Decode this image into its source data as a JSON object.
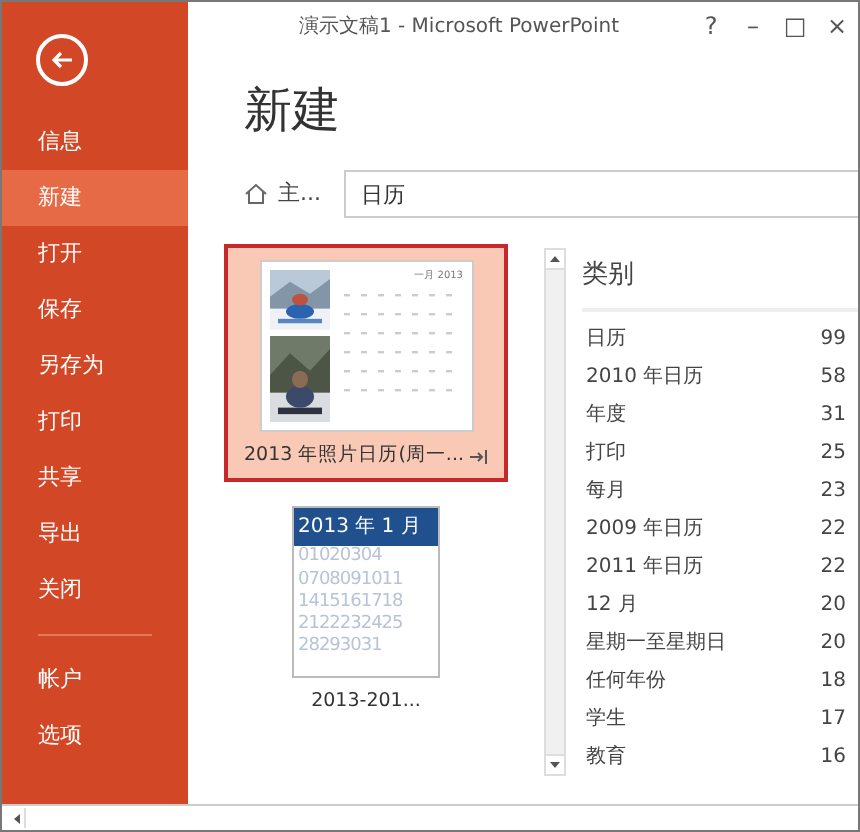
{
  "window": {
    "title": "演示文稿1 - Microsoft PowerPoint",
    "controls": [
      "?",
      "–",
      "□",
      "×"
    ]
  },
  "sidebar": {
    "items": [
      {
        "label": "信息",
        "selected": false
      },
      {
        "label": "新建",
        "selected": true
      },
      {
        "label": "打开",
        "selected": false
      },
      {
        "label": "保存",
        "selected": false
      },
      {
        "label": "另存为",
        "selected": false
      },
      {
        "label": "打印",
        "selected": false
      },
      {
        "label": "共享",
        "selected": false
      },
      {
        "label": "导出",
        "selected": false
      },
      {
        "label": "关闭",
        "selected": false
      }
    ],
    "footer_items": [
      {
        "label": "帐户",
        "selected": false
      },
      {
        "label": "选项",
        "selected": false
      }
    ]
  },
  "heading": "新建",
  "breadcrumb": "主...",
  "search": {
    "value": "日历"
  },
  "templates": [
    {
      "label": "2013 年照片日历(周一...",
      "selected": true,
      "month": "一月 2013"
    },
    {
      "kind": "table",
      "label": "2013-201...",
      "selected": false,
      "month": "2013 年 1 月",
      "rows": [
        "01020304",
        "0708091011",
        "1415161718",
        "2122232425",
        "28293031"
      ]
    }
  ],
  "categories": {
    "title": "类别",
    "items": [
      {
        "name": "日历",
        "count": "99"
      },
      {
        "name": "2010 年日历",
        "count": "58"
      },
      {
        "name": "年度",
        "count": "31"
      },
      {
        "name": "打印",
        "count": "25"
      },
      {
        "name": "每月",
        "count": "23"
      },
      {
        "name": "2009 年日历",
        "count": "22"
      },
      {
        "name": "2011 年日历",
        "count": "22"
      },
      {
        "name": "12 月",
        "count": "20"
      },
      {
        "name": "星期一至星期日",
        "count": "20"
      },
      {
        "name": "任何年份",
        "count": "18"
      },
      {
        "name": "学生",
        "count": "17"
      },
      {
        "name": "教育",
        "count": "16"
      }
    ]
  }
}
